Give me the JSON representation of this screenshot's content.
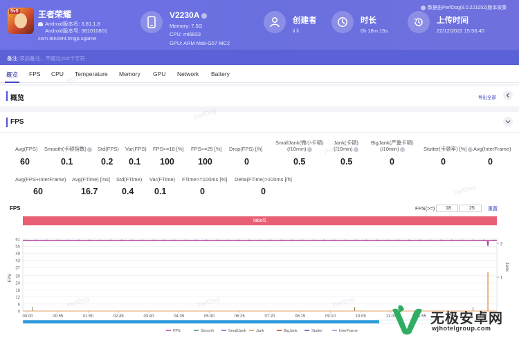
{
  "app": {
    "name": "王者荣耀",
    "android_version": "Android版本名: 3.81.1.8",
    "android_build": "Android版本号: 381010801",
    "package": "com.tencent.tmgp.sgame"
  },
  "device": {
    "name": "V2230A",
    "memory": "Memory: 7.5G",
    "cpu": "CPU: mt6833",
    "gpu": "GPU: ARM Mali-G57 MC2"
  },
  "creator": {
    "title": "创建者",
    "value": "li li"
  },
  "duration": {
    "title": "时长",
    "value": "0h 18m 15s"
  },
  "upload": {
    "title": "上传时间",
    "value": "22/12/2022 15:56:40"
  },
  "data_source": "数据由PerfDog(8.0.221052)版本收集",
  "note": {
    "label": "备注:",
    "placeholder": "添加备注，不超过200个字符"
  },
  "tabs": [
    "概览",
    "FPS",
    "CPU",
    "Temperature",
    "Memory",
    "GPU",
    "Network",
    "Battery"
  ],
  "overview": {
    "title": "概览",
    "export": "导出全部"
  },
  "fps_section": {
    "title": "FPS"
  },
  "metrics_row1": [
    {
      "label": "Avg(FPS)",
      "value": "60"
    },
    {
      "label": "Smooth(卡顿指数)",
      "value": "0.1"
    },
    {
      "label": "Std(FPS)",
      "value": "0.2"
    },
    {
      "label": "Var(FPS)",
      "value": "0.1"
    },
    {
      "label": "FPS>=18 [%]",
      "value": "100"
    },
    {
      "label": "FPS>=25 [%]",
      "value": "100"
    },
    {
      "label": "Drop(FPS) [/h]",
      "value": "0"
    },
    {
      "label": "SmallJank(微小卡顿)",
      "label2": "(/10min)",
      "value": "0.5"
    },
    {
      "label": "Jank(卡顿)",
      "label2": "(/10min)",
      "value": "0.5"
    },
    {
      "label": "BigJank(严重卡顿)",
      "label2": "(/10min)",
      "value": "0"
    },
    {
      "label": "Stutter(卡顿率) [%]",
      "value": "0"
    },
    {
      "label": "Avg(InterFrame)",
      "value": "0"
    }
  ],
  "metrics_row2": [
    {
      "label": "Avg(FPS+InterFrame)",
      "value": "60"
    },
    {
      "label": "Avg(FTime) [ms]",
      "value": "16.7"
    },
    {
      "label": "Std(FTime)",
      "value": "0.4"
    },
    {
      "label": "Var(FTime)",
      "value": "0.1"
    },
    {
      "label": "FTime>=100ms [%]",
      "value": "0"
    },
    {
      "label": "Delta(FTime)>100ms [/h]",
      "value": "0"
    }
  ],
  "chart_controls": {
    "title": "FPS",
    "threshold_label": "FPS(>=)",
    "threshold_1": "18",
    "threshold_2": "25",
    "reset": "重置",
    "label_bar": "label1"
  },
  "watermark_text": "PerfDog",
  "brand": {
    "name": "无极安卓网",
    "url": "wjhotelgroup.com"
  },
  "colors": {
    "header": "#6f72e6",
    "accent": "#3d44c8",
    "fps_line": "#b0409a",
    "label_bar": "#e85f73"
  },
  "chart_data": {
    "type": "line",
    "title": "FPS",
    "ylabel": "FPS",
    "y2label": "Jank",
    "yticks": [
      "0",
      "6",
      "12",
      "18",
      "24",
      "30",
      "37",
      "43",
      "49",
      "55",
      "61"
    ],
    "ylim": [
      0,
      61
    ],
    "y2ticks": [
      "1",
      "2"
    ],
    "y2lim": [
      0,
      2
    ],
    "xticks": [
      "00:00",
      "00:55",
      "01:50",
      "02:45",
      "03:40",
      "04:35",
      "05:30",
      "06:25",
      "07:20",
      "08:15",
      "09:10",
      "10:05",
      "11:00",
      "11:55",
      "12:50",
      "13"
    ],
    "x_range_seconds": [
      0,
      795
    ],
    "series": [
      {
        "name": "FPS",
        "color": "#b0409a",
        "base": 60,
        "dips": [
          {
            "t": 780,
            "y": 55
          }
        ]
      },
      {
        "name": "Smooth",
        "color": "#3a8f8a"
      },
      {
        "name": "SmallJank",
        "color": "#5864c8"
      },
      {
        "name": "Jank",
        "color": "#e08a3a",
        "spikes": [
          {
            "t": 780,
            "y": 1
          }
        ]
      },
      {
        "name": "BigJank",
        "color": "#c0392b"
      },
      {
        "name": "Stutter",
        "color": "#3f51b5"
      },
      {
        "name": "InterFrame",
        "color": "#7d93d8"
      }
    ],
    "grid": true,
    "legend": "bottom"
  }
}
